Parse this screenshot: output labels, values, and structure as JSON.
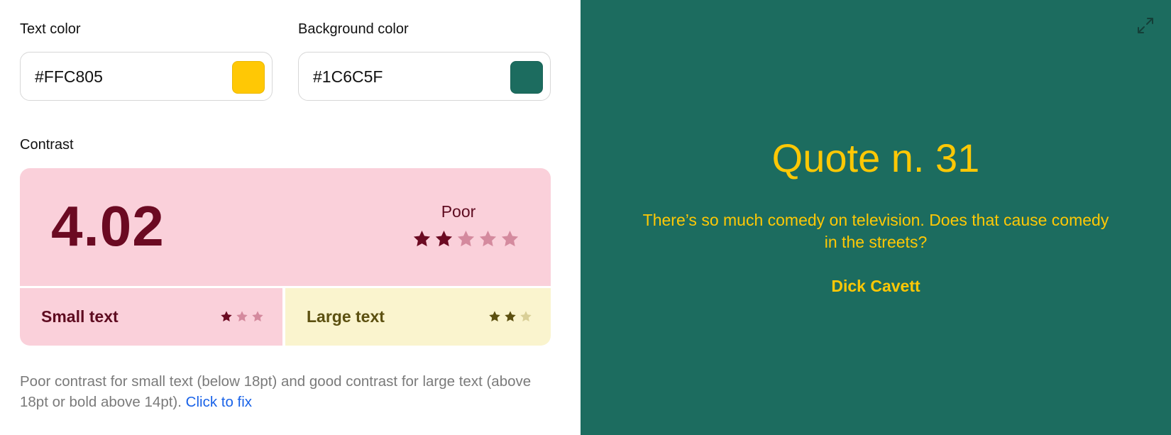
{
  "text_color": {
    "label": "Text color",
    "value": "#FFC805",
    "swatch": "#FFC805"
  },
  "background_color": {
    "label": "Background color",
    "value": "#1C6C5F",
    "swatch": "#1C6C5F"
  },
  "contrast": {
    "label": "Contrast",
    "ratio": "4.02",
    "rating": "Poor",
    "stars_filled": 2,
    "stars_total": 5,
    "card_color": "#FAD0DA",
    "text_color": "#6B0A22"
  },
  "small_text": {
    "label": "Small text",
    "stars_filled": 1,
    "stars_total": 3
  },
  "large_text": {
    "label": "Large text",
    "stars_filled": 2,
    "stars_total": 3
  },
  "description": {
    "text": "Poor contrast for small text (below 18pt) and good contrast for large text (above 18pt or bold above 14pt).",
    "link_text": "Click to fix"
  },
  "preview": {
    "title": "Quote n. 31",
    "quote": "There’s so much comedy on television. Does that cause comedy in the streets?",
    "author": "Dick Cavett",
    "expand_icon": "expand-icon"
  }
}
